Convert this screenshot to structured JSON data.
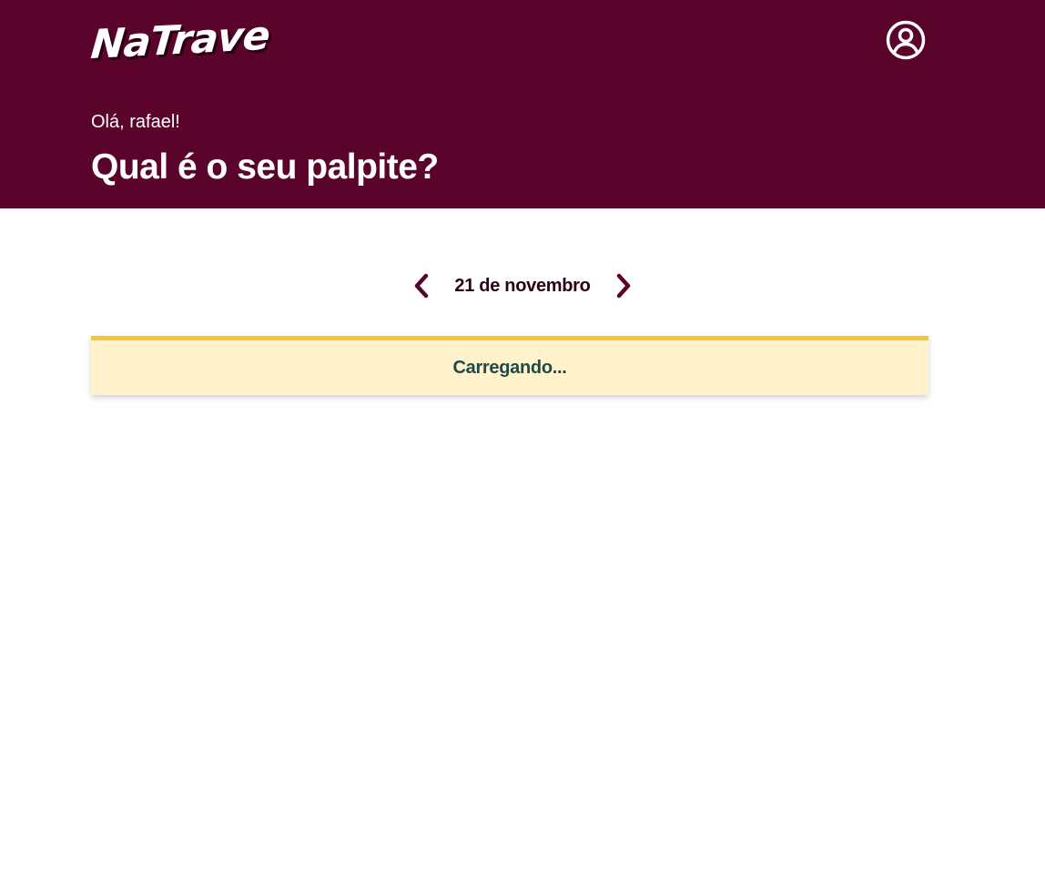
{
  "header": {
    "logo_text": "NaTrave",
    "greeting": "Olá, rafael!",
    "title": "Qual é o seu palpite?",
    "profile_icon": "user-circle-icon"
  },
  "date_nav": {
    "prev_icon": "chevron-left-icon",
    "date_label": "21 de novembro",
    "next_icon": "chevron-right-icon"
  },
  "status": {
    "loading_text": "Carregando..."
  },
  "colors": {
    "brand": "#5a042b",
    "header_text": "#ffffff",
    "loading_bg": "#fff2cc",
    "loading_border": "#f4c730",
    "loading_text": "#1f4a45"
  }
}
